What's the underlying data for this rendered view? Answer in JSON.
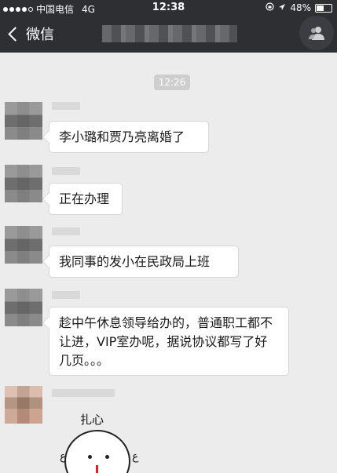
{
  "status_bar": {
    "carrier": "中国电信",
    "network": "4G",
    "time": "12:38",
    "battery": "48%",
    "battery_level": 0.48
  },
  "nav": {
    "back_label": "微信"
  },
  "chat": {
    "time_divider": "12:26",
    "messages": [
      {
        "text": "李小璐和贾乃亮离婚了"
      },
      {
        "text": "正在办理"
      },
      {
        "text": "我同事的发小在民政局上班"
      },
      {
        "text": "趁中午休息领导给办的，普通职工都不让进，VIP室办呢，据说协议都写了好几页。。。"
      }
    ],
    "sticker_text": "扎心"
  },
  "colors": {
    "header_bg": "#2e2f33",
    "chat_bg": "#ececec",
    "bubble_bg": "#ffffff"
  }
}
